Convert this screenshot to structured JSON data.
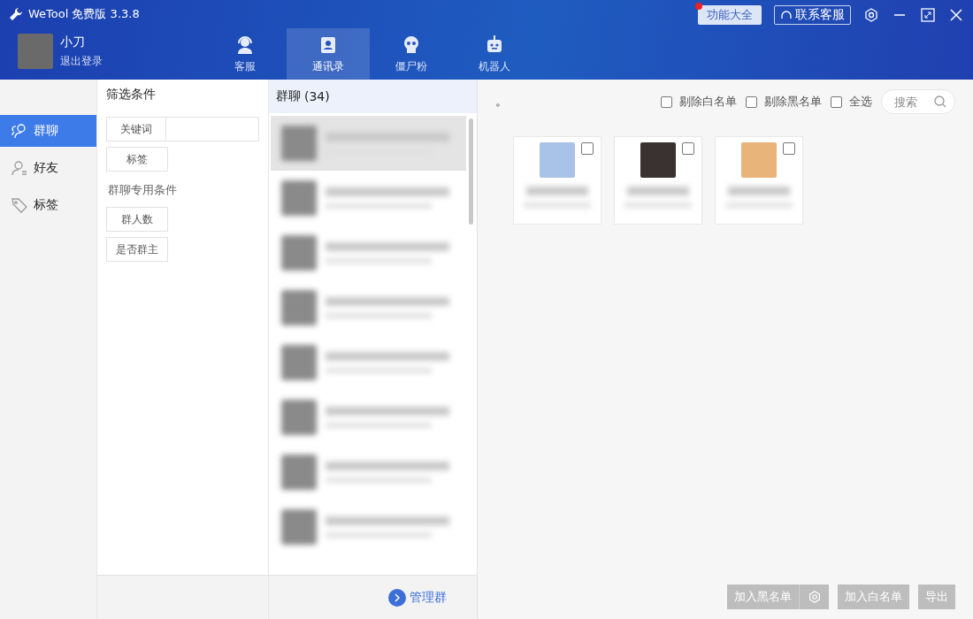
{
  "window": {
    "title": "WeTool 免费版 3.3.8",
    "buttons": [
      {
        "label": "功能大全",
        "kind": "feature",
        "badge": true
      },
      {
        "label": "联系客服",
        "kind": "support",
        "badge": false
      }
    ]
  },
  "user": {
    "name": "小刀",
    "logout": "退出登录"
  },
  "tabs": [
    {
      "label": "客服",
      "selected": false
    },
    {
      "label": "通讯录",
      "selected": true
    },
    {
      "label": "僵尸粉",
      "selected": false
    },
    {
      "label": "机器人",
      "selected": false
    }
  ],
  "sidebar": {
    "items": [
      {
        "label": "群聊",
        "selected": true
      },
      {
        "label": "好友",
        "selected": false
      },
      {
        "label": "标签",
        "selected": false
      }
    ]
  },
  "filter": {
    "title": "筛选条件",
    "keyword": "关键词",
    "tag": "标签",
    "group_title": "群聊专用条件",
    "group_buttons": [
      "群人数",
      "是否群主"
    ]
  },
  "group_list": {
    "title": "群聊",
    "count": "(34)",
    "items": [
      {
        "selected": true
      },
      {
        "selected": false
      },
      {
        "selected": false
      },
      {
        "selected": false
      },
      {
        "selected": false
      },
      {
        "selected": false
      },
      {
        "selected": false
      },
      {
        "selected": false
      }
    ],
    "manage": "管理群"
  },
  "content": {
    "mark": "。",
    "options": [
      {
        "label": "剔除白名单",
        "checked": false
      },
      {
        "label": "剔除黑名单",
        "checked": false
      },
      {
        "label": "全选",
        "checked": false
      }
    ],
    "search": {
      "placeholder": "搜索"
    },
    "cards": [
      {
        "checked": false
      },
      {
        "checked": false
      },
      {
        "checked": false
      }
    ]
  },
  "footer": {
    "buttons": [
      "加入黑名单",
      "加入白名单",
      "导出"
    ]
  }
}
